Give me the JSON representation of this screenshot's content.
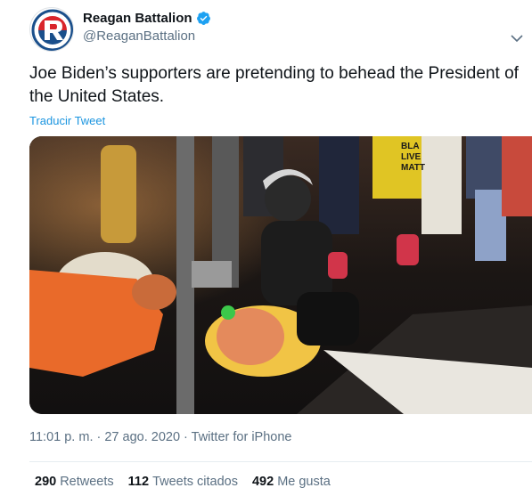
{
  "tweet": {
    "display_name": "Reagan Battalion",
    "handle": "@ReaganBattalion",
    "verified": true,
    "text": "Joe Biden’s supporters are pretending to behead the President of the United States.",
    "translate_label": "Traducir Tweet",
    "timestamp": "11:01 p. m. · 27 ago. 2020",
    "client": "Twitter for iPhone",
    "media_icons": [
      "guillotine-prop",
      "trump-effigy-head",
      "protester-figure"
    ],
    "media_sign_text": "BLA\nLIVE\nMATT",
    "colors": {
      "verified": "#1da1f2",
      "link": "#1b95e0",
      "logo_red": "#d9252b",
      "logo_blue": "#1a4f8b"
    }
  },
  "stats": {
    "retweets": {
      "count": "290",
      "label": "Retweets"
    },
    "quotes": {
      "count": "112",
      "label": "Tweets citados"
    },
    "likes": {
      "count": "492",
      "label": "Me gusta"
    }
  }
}
